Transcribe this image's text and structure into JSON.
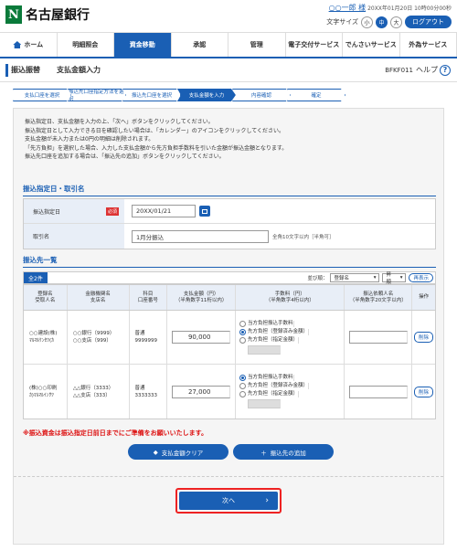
{
  "header": {
    "logo_mark": "N",
    "logo_text": "名古屋銀行",
    "user_name": "○○一郎 様",
    "last_login": "20XX年01月20日 10時00分00秒",
    "font_size_label": "文字サイズ",
    "font_sizes": [
      "小",
      "中",
      "大"
    ],
    "logout": "ログアウト"
  },
  "nav": [
    "ホーム",
    "明細照会",
    "資金移動",
    "承認",
    "管理",
    "電子交付サービス",
    "でんさいサービス",
    "外為サービス"
  ],
  "title": {
    "main": "振込振替",
    "sub": "支払金額入力",
    "screen_id": "BFKF011",
    "help": "ヘルプ"
  },
  "steps": [
    "支払口座を選択",
    "振込先口座指定方法を選択",
    "振込先口座を選択",
    "支払金額を入力",
    "内容確認",
    "確定"
  ],
  "instructions": [
    "振込指定日、支払金額を入力の上、「次へ」ボタンをクリックしてください。",
    "振込指定日として入力できる日を確認したい場合は、「カレンダー」のアイコンをクリックしてください。",
    "支払金額が未入力または0円の明細は削除されます。",
    "「先方負担」を選択した場合、入力した支払金額から先方負担手数料を引いた金額が振込金額となります。",
    "振込先口座を追加する場合は、「振込先の追加」ボタンをクリックしてください。"
  ],
  "date_section": {
    "heading": "振込指定日・取引名",
    "date_label": "振込指定日",
    "required": "必須",
    "date_value": "20XX/01/21",
    "name_label": "取引名",
    "name_value": "1月分振込",
    "name_hint": "全角10文字以内［半角可］"
  },
  "list": {
    "heading": "振込先一覧",
    "count": "全2件",
    "sort_label": "並び順：",
    "sort_value": "登録名",
    "order_value": "昇順",
    "redisplay": "再表示",
    "headers": [
      [
        "登録名",
        "受取人名"
      ],
      [
        "金融機関名",
        "支店名"
      ],
      [
        "科目",
        "口座番号"
      ],
      [
        "支払金額（円）",
        "（半角数字11桁以内）"
      ],
      [
        "手数料（円）",
        "（半角数字4桁以内）"
      ],
      [
        "振込依頼人名",
        "（半角数字20文字以内）"
      ],
      [
        "操作"
      ]
    ],
    "rows": [
      {
        "name": "○○建設(株)",
        "kana": "ﾏﾙﾏﾙｹﾝｾﾂ(ｶ",
        "bank": "○○銀行（9999）",
        "branch": "○○支店（999）",
        "type": "普通",
        "acct": "9999999",
        "amount": "90,000",
        "fee_opts": [
          "当方負担振込手数料",
          "先方負担（登録済み金額）",
          "先方負担（指定金額）"
        ],
        "selected": 1,
        "delete": "削除"
      },
      {
        "name": "(株)○○印刷",
        "kana": "ｶ)ﾏﾙﾏﾙｲﾝｻﾂ",
        "bank": "△△銀行（3333）",
        "branch": "△△支店（333）",
        "type": "普通",
        "acct": "3333333",
        "amount": "27,000",
        "fee_opts": [
          "当方負担振込手数料",
          "先方負担（登録済み金額）",
          "先方負担（指定金額）"
        ],
        "selected": 0,
        "delete": "削除"
      }
    ]
  },
  "warning": "※振込資金は振込指定日前日までにご準備をお願いいたします。",
  "buttons": {
    "clear": "支払金額クリア",
    "add": "振込先の追加",
    "next": "次へ"
  }
}
